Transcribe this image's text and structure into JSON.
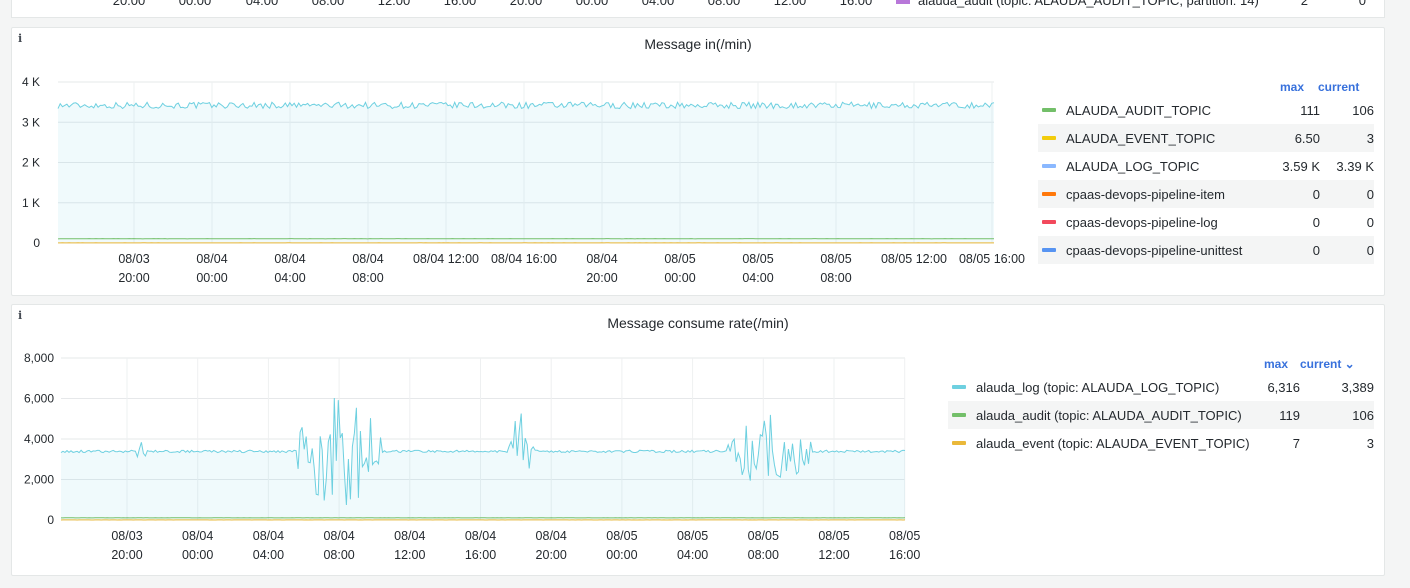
{
  "top_strip": {
    "ticks": [
      "20:00",
      "00:00",
      "04:00",
      "08:00",
      "12:00",
      "16:00",
      "20:00",
      "00:00",
      "04:00",
      "08:00",
      "12:00",
      "16:00"
    ],
    "legend_label": "alauda_audit (topic: ALAUDA_AUDIT_TOPIC, partition: 14)",
    "legend_max": "2",
    "legend_current": "0",
    "swatch_color": "#b877d9"
  },
  "panels": [
    {
      "title": "Message in(/min)",
      "info_icon": "info-icon",
      "legend_headers": {
        "max": "max",
        "current": "current"
      },
      "legend": [
        {
          "name": "ALAUDA_AUDIT_TOPIC",
          "max": "111",
          "current": "106",
          "color": "#73bf69"
        },
        {
          "name": "ALAUDA_EVENT_TOPIC",
          "max": "6.50",
          "current": "3",
          "color": "#f2cc0c"
        },
        {
          "name": "ALAUDA_LOG_TOPIC",
          "max": "3.59 K",
          "current": "3.39 K",
          "color": "#8ab8ff"
        },
        {
          "name": "cpaas-devops-pipeline-item",
          "max": "0",
          "current": "0",
          "color": "#ff780a"
        },
        {
          "name": "cpaas-devops-pipeline-log",
          "max": "0",
          "current": "0",
          "color": "#f2495c"
        },
        {
          "name": "cpaas-devops-pipeline-unittest",
          "max": "0",
          "current": "0",
          "color": "#5794f2"
        }
      ]
    },
    {
      "title": "Message consume rate(/min)",
      "info_icon": "info-icon",
      "legend_headers": {
        "max": "max",
        "current": "current ⌄"
      },
      "legend": [
        {
          "name": "alauda_log (topic: ALAUDA_LOG_TOPIC)",
          "max": "6,316",
          "current": "3,389",
          "color": "#6ed0e0"
        },
        {
          "name": "alauda_audit (topic: ALAUDA_AUDIT_TOPIC)",
          "max": "119",
          "current": "106",
          "color": "#73bf69"
        },
        {
          "name": "alauda_event (topic: ALAUDA_EVENT_TOPIC)",
          "max": "7",
          "current": "3",
          "color": "#eab839"
        }
      ]
    }
  ],
  "chart_data": [
    {
      "type": "line",
      "title": "Message in(/min)",
      "y_ticks": [
        "0",
        "1 K",
        "2 K",
        "3 K",
        "4 K"
      ],
      "ylim": [
        0,
        4000
      ],
      "x_ticks": [
        [
          "08/03",
          "20:00"
        ],
        [
          "08/04",
          "00:00"
        ],
        [
          "08/04",
          "04:00"
        ],
        [
          "08/04",
          "08:00"
        ],
        [
          "08/04 12:00",
          ""
        ],
        [
          "08/04 16:00",
          ""
        ],
        [
          "08/04",
          "20:00"
        ],
        [
          "08/05",
          "00:00"
        ],
        [
          "08/05",
          "04:00"
        ],
        [
          "08/05",
          "08:00"
        ],
        [
          "08/05 12:00",
          ""
        ],
        [
          "08/05 16:00",
          ""
        ]
      ],
      "series": [
        {
          "name": "ALAUDA_LOG_TOPIC",
          "color": "#6ed0e0",
          "base": 3420,
          "noise": 80,
          "bursts": []
        },
        {
          "name": "ALAUDA_AUDIT_TOPIC",
          "color": "#73bf69",
          "base": 106,
          "noise": 3,
          "bursts": []
        },
        {
          "name": "ALAUDA_EVENT_TOPIC",
          "color": "#eab839",
          "base": 3,
          "noise": 1,
          "bursts": []
        }
      ]
    },
    {
      "type": "line",
      "title": "Message consume rate(/min)",
      "y_ticks": [
        "0",
        "2,000",
        "4,000",
        "6,000",
        "8,000"
      ],
      "ylim": [
        0,
        8000
      ],
      "x_ticks": [
        [
          "08/03",
          "20:00"
        ],
        [
          "08/04",
          "00:00"
        ],
        [
          "08/04",
          "04:00"
        ],
        [
          "08/04",
          "08:00"
        ],
        [
          "08/04",
          "12:00"
        ],
        [
          "08/04",
          "16:00"
        ],
        [
          "08/04",
          "20:00"
        ],
        [
          "08/05",
          "00:00"
        ],
        [
          "08/05",
          "04:00"
        ],
        [
          "08/05",
          "08:00"
        ],
        [
          "08/05",
          "12:00"
        ],
        [
          "08/05",
          "16:00"
        ]
      ],
      "series": [
        {
          "name": "alauda_log (topic: ALAUDA_LOG_TOPIC)",
          "color": "#6ed0e0",
          "base": 3389,
          "noise": 60,
          "bursts": [
            [
              0.09,
              0.1,
              900
            ],
            [
              0.28,
              0.38,
              2900
            ],
            [
              0.53,
              0.56,
              1900
            ],
            [
              0.79,
              0.89,
              1800
            ]
          ]
        },
        {
          "name": "alauda_audit (topic: ALAUDA_AUDIT_TOPIC)",
          "color": "#73bf69",
          "base": 106,
          "noise": 4,
          "bursts": []
        },
        {
          "name": "alauda_event (topic: ALAUDA_EVENT_TOPIC)",
          "color": "#eab839",
          "base": 3,
          "noise": 1,
          "bursts": []
        }
      ]
    }
  ]
}
